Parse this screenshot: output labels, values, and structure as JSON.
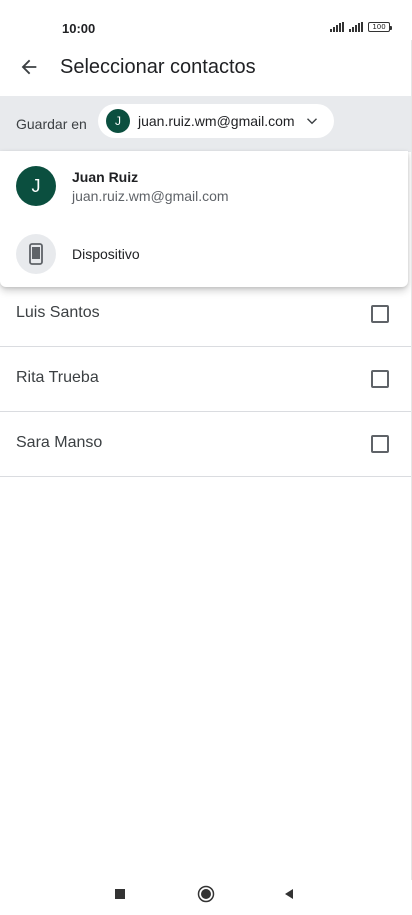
{
  "status_bar": {
    "time": "10:00",
    "battery_level": "100",
    "icons": [
      "signal-icon",
      "signal-icon",
      "battery-icon"
    ]
  },
  "app_bar": {
    "back_icon": "arrow-back-icon",
    "title": "Seleccionar contactos"
  },
  "save_to": {
    "label": "Guardar en",
    "account_initial": "J",
    "account_email": "juan.ruiz.wm@gmail.com",
    "chevron_icon": "chevron-down-icon",
    "avatar_color": "#0b4f3f"
  },
  "dropdown": {
    "items": [
      {
        "initial": "J",
        "name": "Juan Ruiz",
        "email": "juan.ruiz.wm@gmail.com"
      },
      {
        "icon": "smartphone-icon",
        "label": "Dispositivo"
      }
    ]
  },
  "contacts": [
    {
      "name": "Luis Santos",
      "checked": false
    },
    {
      "name": "Rita Trueba",
      "checked": false
    },
    {
      "name": "Sara Manso",
      "checked": false
    }
  ],
  "nav_bar": {
    "icons": [
      "recents-icon",
      "home-icon",
      "back-icon"
    ]
  }
}
